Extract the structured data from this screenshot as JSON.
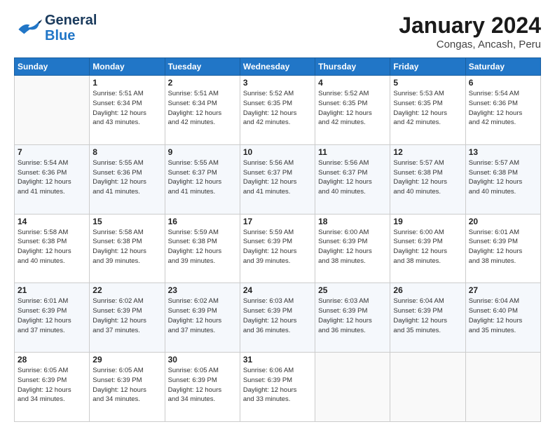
{
  "logo": {
    "line1": "General",
    "line2": "Blue"
  },
  "title": "January 2024",
  "subtitle": "Congas, Ancash, Peru",
  "weekdays": [
    "Sunday",
    "Monday",
    "Tuesday",
    "Wednesday",
    "Thursday",
    "Friday",
    "Saturday"
  ],
  "weeks": [
    [
      {
        "day": "",
        "info": ""
      },
      {
        "day": "1",
        "info": "Sunrise: 5:51 AM\nSunset: 6:34 PM\nDaylight: 12 hours\nand 43 minutes."
      },
      {
        "day": "2",
        "info": "Sunrise: 5:51 AM\nSunset: 6:34 PM\nDaylight: 12 hours\nand 42 minutes."
      },
      {
        "day": "3",
        "info": "Sunrise: 5:52 AM\nSunset: 6:35 PM\nDaylight: 12 hours\nand 42 minutes."
      },
      {
        "day": "4",
        "info": "Sunrise: 5:52 AM\nSunset: 6:35 PM\nDaylight: 12 hours\nand 42 minutes."
      },
      {
        "day": "5",
        "info": "Sunrise: 5:53 AM\nSunset: 6:35 PM\nDaylight: 12 hours\nand 42 minutes."
      },
      {
        "day": "6",
        "info": "Sunrise: 5:54 AM\nSunset: 6:36 PM\nDaylight: 12 hours\nand 42 minutes."
      }
    ],
    [
      {
        "day": "7",
        "info": "Sunrise: 5:54 AM\nSunset: 6:36 PM\nDaylight: 12 hours\nand 41 minutes."
      },
      {
        "day": "8",
        "info": "Sunrise: 5:55 AM\nSunset: 6:36 PM\nDaylight: 12 hours\nand 41 minutes."
      },
      {
        "day": "9",
        "info": "Sunrise: 5:55 AM\nSunset: 6:37 PM\nDaylight: 12 hours\nand 41 minutes."
      },
      {
        "day": "10",
        "info": "Sunrise: 5:56 AM\nSunset: 6:37 PM\nDaylight: 12 hours\nand 41 minutes."
      },
      {
        "day": "11",
        "info": "Sunrise: 5:56 AM\nSunset: 6:37 PM\nDaylight: 12 hours\nand 40 minutes."
      },
      {
        "day": "12",
        "info": "Sunrise: 5:57 AM\nSunset: 6:38 PM\nDaylight: 12 hours\nand 40 minutes."
      },
      {
        "day": "13",
        "info": "Sunrise: 5:57 AM\nSunset: 6:38 PM\nDaylight: 12 hours\nand 40 minutes."
      }
    ],
    [
      {
        "day": "14",
        "info": "Sunrise: 5:58 AM\nSunset: 6:38 PM\nDaylight: 12 hours\nand 40 minutes."
      },
      {
        "day": "15",
        "info": "Sunrise: 5:58 AM\nSunset: 6:38 PM\nDaylight: 12 hours\nand 39 minutes."
      },
      {
        "day": "16",
        "info": "Sunrise: 5:59 AM\nSunset: 6:38 PM\nDaylight: 12 hours\nand 39 minutes."
      },
      {
        "day": "17",
        "info": "Sunrise: 5:59 AM\nSunset: 6:39 PM\nDaylight: 12 hours\nand 39 minutes."
      },
      {
        "day": "18",
        "info": "Sunrise: 6:00 AM\nSunset: 6:39 PM\nDaylight: 12 hours\nand 38 minutes."
      },
      {
        "day": "19",
        "info": "Sunrise: 6:00 AM\nSunset: 6:39 PM\nDaylight: 12 hours\nand 38 minutes."
      },
      {
        "day": "20",
        "info": "Sunrise: 6:01 AM\nSunset: 6:39 PM\nDaylight: 12 hours\nand 38 minutes."
      }
    ],
    [
      {
        "day": "21",
        "info": "Sunrise: 6:01 AM\nSunset: 6:39 PM\nDaylight: 12 hours\nand 37 minutes."
      },
      {
        "day": "22",
        "info": "Sunrise: 6:02 AM\nSunset: 6:39 PM\nDaylight: 12 hours\nand 37 minutes."
      },
      {
        "day": "23",
        "info": "Sunrise: 6:02 AM\nSunset: 6:39 PM\nDaylight: 12 hours\nand 37 minutes."
      },
      {
        "day": "24",
        "info": "Sunrise: 6:03 AM\nSunset: 6:39 PM\nDaylight: 12 hours\nand 36 minutes."
      },
      {
        "day": "25",
        "info": "Sunrise: 6:03 AM\nSunset: 6:39 PM\nDaylight: 12 hours\nand 36 minutes."
      },
      {
        "day": "26",
        "info": "Sunrise: 6:04 AM\nSunset: 6:39 PM\nDaylight: 12 hours\nand 35 minutes."
      },
      {
        "day": "27",
        "info": "Sunrise: 6:04 AM\nSunset: 6:40 PM\nDaylight: 12 hours\nand 35 minutes."
      }
    ],
    [
      {
        "day": "28",
        "info": "Sunrise: 6:05 AM\nSunset: 6:39 PM\nDaylight: 12 hours\nand 34 minutes."
      },
      {
        "day": "29",
        "info": "Sunrise: 6:05 AM\nSunset: 6:39 PM\nDaylight: 12 hours\nand 34 minutes."
      },
      {
        "day": "30",
        "info": "Sunrise: 6:05 AM\nSunset: 6:39 PM\nDaylight: 12 hours\nand 34 minutes."
      },
      {
        "day": "31",
        "info": "Sunrise: 6:06 AM\nSunset: 6:39 PM\nDaylight: 12 hours\nand 33 minutes."
      },
      {
        "day": "",
        "info": ""
      },
      {
        "day": "",
        "info": ""
      },
      {
        "day": "",
        "info": ""
      }
    ]
  ]
}
